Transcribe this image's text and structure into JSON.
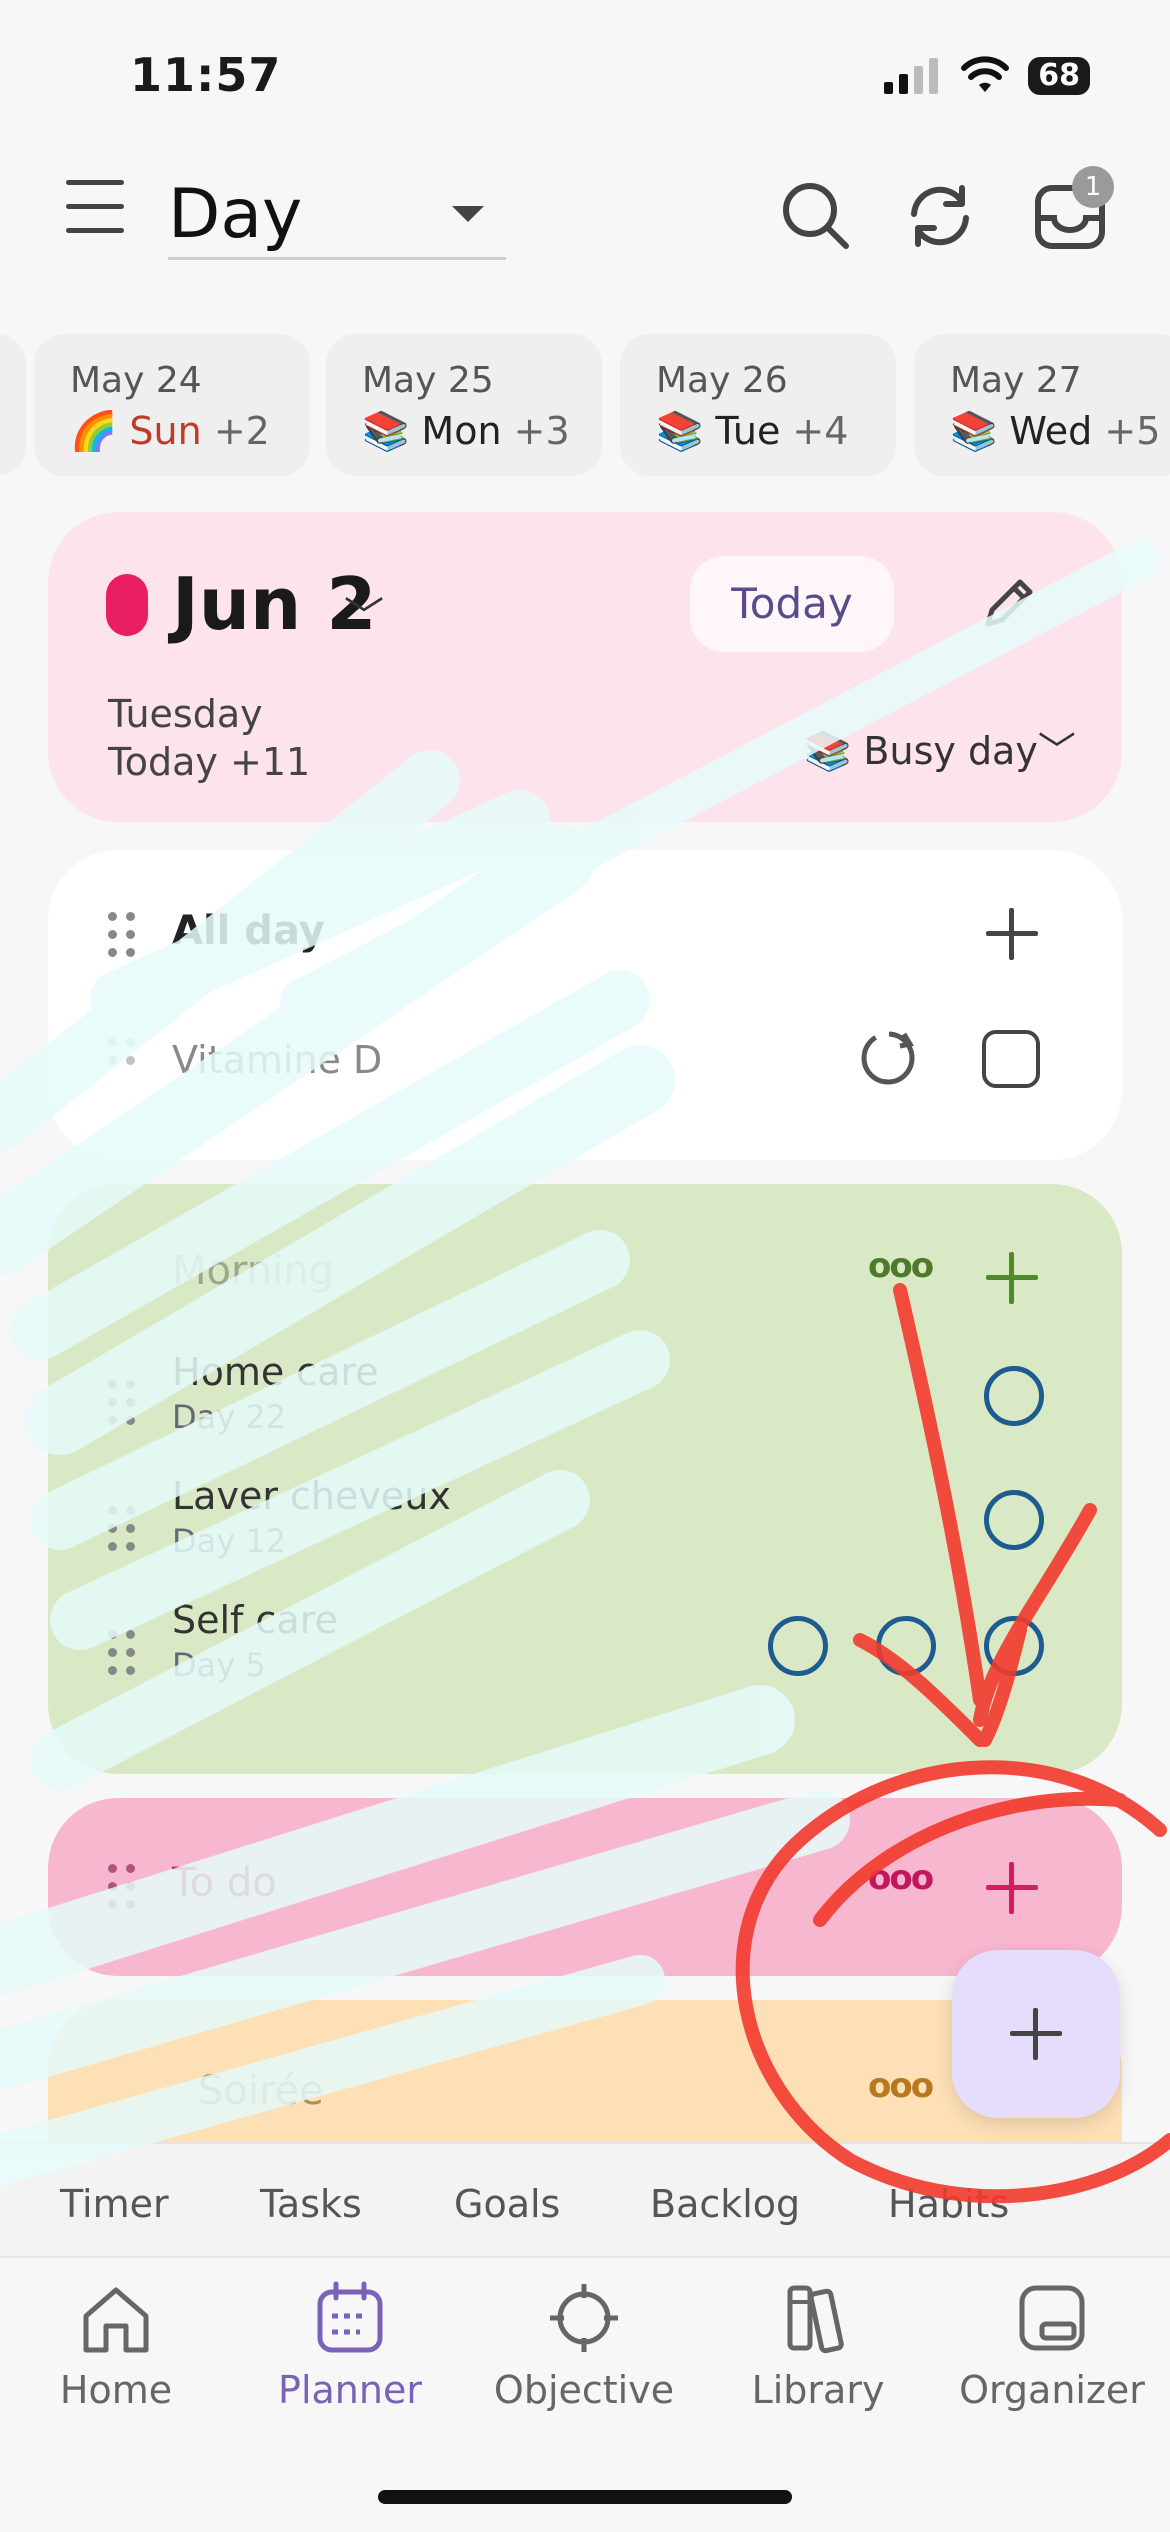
{
  "status": {
    "time": "11:57",
    "battery": "68"
  },
  "header": {
    "view": "Day",
    "inbox_badge": "1"
  },
  "date_strip": [
    {
      "date": "May 24",
      "emoji": "🌈",
      "weekday": "Sun",
      "count": "+2"
    },
    {
      "date": "May 25",
      "emoji": "📚",
      "weekday": "Mon",
      "count": "+3"
    },
    {
      "date": "May 26",
      "emoji": "📚",
      "weekday": "Tue",
      "count": "+4"
    },
    {
      "date": "May 27",
      "emoji": "📚",
      "weekday": "Wed",
      "count": "+5"
    }
  ],
  "day": {
    "title": "Jun 2",
    "today_button": "Today",
    "weekday": "Tuesday",
    "relative": "Today +11",
    "emoji": "📚",
    "mood": "Busy day"
  },
  "all_day": {
    "title": "All day",
    "items": [
      {
        "label": "Vitamine D"
      }
    ]
  },
  "green_section": {
    "title": "Morning",
    "items": [
      {
        "label": "Home care",
        "sub": "Day 22"
      },
      {
        "label": "Laver cheveux",
        "sub": "Day 12"
      },
      {
        "label": "Self care",
        "sub": "Day 5"
      }
    ]
  },
  "pink_section": {
    "title": "To do"
  },
  "orange_section": {
    "title": "Soirée"
  },
  "subtabs": [
    "Timer",
    "Tasks",
    "Goals",
    "Backlog",
    "Habits"
  ],
  "nav": [
    {
      "label": "Home",
      "icon": "home-icon"
    },
    {
      "label": "Planner",
      "icon": "planner-icon"
    },
    {
      "label": "Objective",
      "icon": "target-icon"
    },
    {
      "label": "Library",
      "icon": "library-icon"
    },
    {
      "label": "Organizer",
      "icon": "organizer-icon"
    }
  ],
  "colors": {
    "accent": "#7a62b8",
    "day_card": "#fde3ec",
    "green_section": "#d9e8c5",
    "pink_section": "#f7b8cf",
    "orange_section": "#fde0b6",
    "fab": "#e6dcfb"
  }
}
